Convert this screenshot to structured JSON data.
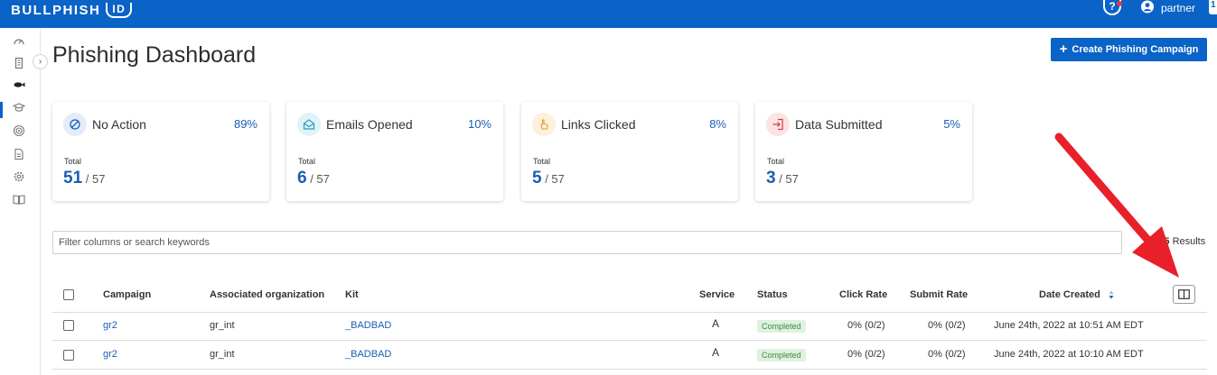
{
  "header": {
    "logo_text": "BULLPHISH",
    "logo_id": "ID",
    "help_label": "?",
    "user_name": "partner",
    "corner_badge": "1"
  },
  "colors": {
    "brand": "#0a63c6",
    "accent_link": "#1a5fb4",
    "status_completed_bg": "#dff1df",
    "annotation_arrow": "#e8202a"
  },
  "sidebar": {
    "icons": [
      "dashboard-icon",
      "building-icon",
      "fish-icon",
      "graduation-cap-icon",
      "target-icon",
      "document-icon",
      "settings-icon",
      "book-icon"
    ],
    "active_index": 2,
    "collapse_label": "›"
  },
  "page": {
    "title": "Phishing Dashboard",
    "create_button": "Create Phishing Campaign",
    "create_plus": "+"
  },
  "cards": [
    {
      "title": "No Action",
      "pct": "89%",
      "total_label": "Total",
      "value": "51",
      "of": "/ 57",
      "icon": "no-action-icon"
    },
    {
      "title": "Emails Opened",
      "pct": "10%",
      "total_label": "Total",
      "value": "6",
      "of": "/ 57",
      "icon": "envelope-open-icon"
    },
    {
      "title": "Links Clicked",
      "pct": "8%",
      "total_label": "Total",
      "value": "5",
      "of": "/ 57",
      "icon": "pointer-hand-icon"
    },
    {
      "title": "Data Submitted",
      "pct": "5%",
      "total_label": "Total",
      "value": "3",
      "of": "/ 57",
      "icon": "sign-in-icon"
    }
  ],
  "filter": {
    "placeholder": "Filter columns or search keywords"
  },
  "results": {
    "prefix": "of",
    "count": "15",
    "suffix": "Results"
  },
  "table": {
    "headers": {
      "campaign": "Campaign",
      "org": "Associated organization",
      "kit": "Kit",
      "service": "Service",
      "status": "Status",
      "click_rate": "Click Rate",
      "submit_rate": "Submit Rate",
      "date_created": "Date Created"
    },
    "rows": [
      {
        "campaign": "gr2",
        "org": "gr_int",
        "kit": "_BADBAD",
        "service": "A",
        "status": "Completed",
        "click_rate": "0% (0/2)",
        "submit_rate": "0% (0/2)",
        "date_created": "June 24th, 2022 at 10:51 AM EDT"
      },
      {
        "campaign": "gr2",
        "org": "gr_int",
        "kit": "_BADBAD",
        "service": "A",
        "status": "Completed",
        "click_rate": "0% (0/2)",
        "submit_rate": "0% (0/2)",
        "date_created": "June 24th, 2022 at 10:10 AM EDT"
      }
    ]
  }
}
